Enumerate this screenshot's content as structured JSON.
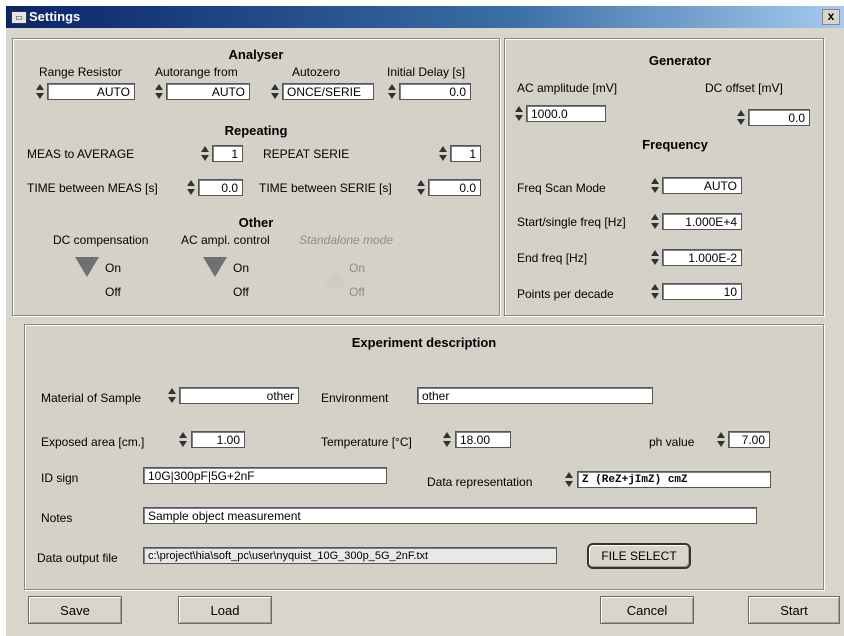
{
  "window": {
    "title": "Settings",
    "close": "x"
  },
  "analyser": {
    "heading": "Analyser",
    "range_resistor": {
      "label": "Range Resistor",
      "value": "AUTO"
    },
    "autorange_from": {
      "label": "Autorange from",
      "value": "AUTO"
    },
    "autozero": {
      "label": "Autozero",
      "value": "ONCE/SERIE"
    },
    "initial_delay": {
      "label": "Initial Delay [s]",
      "value": "0.0"
    }
  },
  "repeating": {
    "heading": "Repeating",
    "meas_to_average": {
      "label": "MEAS to AVERAGE",
      "value": "1"
    },
    "repeat_serie": {
      "label": "REPEAT SERIE",
      "value": "1"
    },
    "time_between_meas": {
      "label": "TIME between MEAS [s]",
      "value": "0.0"
    },
    "time_between_serie": {
      "label": "TIME between SERIE [s]",
      "value": "0.0"
    }
  },
  "other": {
    "heading": "Other",
    "dc_compensation": {
      "label": "DC compensation",
      "on": "On",
      "off": "Off"
    },
    "ac_ampl_control": {
      "label": "AC ampl. control",
      "on": "On",
      "off": "Off"
    },
    "standalone_mode": {
      "label": "Standalone mode",
      "on": "On",
      "off": "Off"
    }
  },
  "generator": {
    "heading": "Generator",
    "ac_amplitude": {
      "label": "AC amplitude [mV]",
      "value": "1000.0"
    },
    "dc_offset": {
      "label": "DC offset [mV]",
      "value": "0.0"
    }
  },
  "frequency": {
    "heading": "Frequency",
    "scan_mode": {
      "label": "Freq Scan Mode",
      "value": "AUTO"
    },
    "start_freq": {
      "label": "Start/single freq [Hz]",
      "value": "1.000E+4"
    },
    "end_freq": {
      "label": "End freq [Hz]",
      "value": "1.000E-2"
    },
    "points_per_decade": {
      "label": "Points per decade",
      "value": "10"
    }
  },
  "experiment": {
    "heading": "Experiment description",
    "material": {
      "label": "Material of Sample",
      "value": "other"
    },
    "environment": {
      "label": "Environment",
      "value": "other"
    },
    "exposed_area": {
      "label": "Exposed area [cm.]",
      "value": "1.00"
    },
    "temperature": {
      "label": "Temperature [°C]",
      "value": "18.00"
    },
    "ph_value": {
      "label": "ph value",
      "value": "7.00"
    },
    "id_sign": {
      "label": "ID sign",
      "value": "10G|300pF|5G+2nF"
    },
    "data_representation": {
      "label": "Data representation",
      "value": "Z (ReZ+jImZ) cmZ"
    },
    "notes": {
      "label": "Notes",
      "value": "Sample object measurement"
    },
    "data_output_file": {
      "label": "Data output file",
      "value": "c:\\project\\hia\\soft_pc\\user\\nyquist_10G_300p_5G_2nF.txt"
    },
    "file_select_label": "FILE SELECT"
  },
  "buttons": {
    "save": "Save",
    "load": "Load",
    "cancel": "Cancel",
    "start": "Start"
  }
}
